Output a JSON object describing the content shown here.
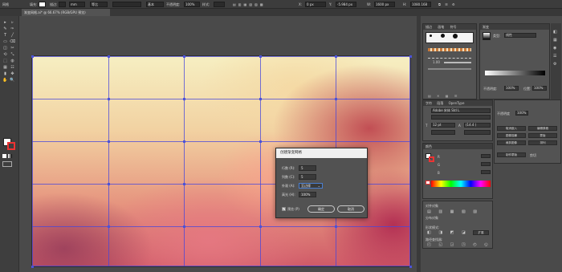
{
  "control_bar": {
    "object_type": "网格",
    "items": [
      {
        "name": "fill-label",
        "text": "填充:"
      },
      {
        "name": "stroke-label",
        "text": "描边:"
      },
      {
        "name": "stroke-weight",
        "text": "mm"
      },
      {
        "name": "brush-label",
        "text": "等比"
      },
      {
        "name": "style-label",
        "text": "基本"
      },
      {
        "name": "opacity-label",
        "text": "不透明度:"
      },
      {
        "name": "style2-label",
        "text": "样式:"
      }
    ],
    "basic_label": "基本",
    "opacity_value": "100%",
    "x_value": "0 px",
    "y_value": "-5.984 px",
    "w_value": "1600 px",
    "h_value": "1080.168"
  },
  "document_tab": {
    "title": "渐变网格.ai* @ 66.67% (RGB/GPU 预览)",
    "close": "×"
  },
  "toolbar": {
    "tools": [
      "▸",
      "▹",
      "✎",
      "✑",
      "T",
      "╱",
      "▭",
      "⌫",
      "◫",
      "✂",
      "⟲",
      "⤡",
      "⬚",
      "◍",
      "▦",
      "☷",
      "▮",
      "✥",
      "✋",
      "🔍"
    ]
  },
  "canvas": {
    "grid_rows": 5,
    "grid_cols": 5
  },
  "dialog": {
    "title": "创建渐变网格",
    "rows_label": "行数 (R):",
    "rows_value": "5",
    "cols_label": "列数 (C):",
    "cols_value": "5",
    "appearance_label": "外观 (A):",
    "appearance_value": "至边缘",
    "highlight_label": "高光 (H):",
    "highlight_value": "100%",
    "preview_label": "预览 (P)",
    "preview_checked": true,
    "ok_label": "确定",
    "cancel_label": "取消"
  },
  "panels": {
    "brushes": {
      "tabs": [
        "描边",
        "画笔",
        "符号"
      ],
      "stroke_weight_label": "1.00"
    },
    "gradient": {
      "tab": "渐变",
      "type_label": "类型:",
      "type_value": "线性",
      "opacity_label": "不透明度:",
      "opacity_value": "100%",
      "location_label": "位置:",
      "location_value": "100%"
    },
    "character": {
      "tabs": [
        "字符",
        "段落",
        "OpenType"
      ],
      "font": "Adobe 宋体 Std L",
      "size_value": "12 pt",
      "leading_value": "(14.4 )"
    },
    "color": {
      "tab": "颜色",
      "channels": [
        "R",
        "G",
        "B"
      ]
    },
    "transparency": {
      "opacity_label": "不透明度",
      "opacity_value": "100%",
      "mask_button": "制作蒙版",
      "clip_label": "剪切"
    },
    "align": {
      "label": "对齐对象",
      "dist_label": "分布对象"
    },
    "pathfinder": {
      "shape_label": "形状模式:",
      "path_label": "路径查找器:",
      "expand_button": "扩展"
    },
    "buttons": {
      "b1": "取消嵌入",
      "b2": "编辑原稿",
      "b3": "图像描摹",
      "b4": "蒙版",
      "b5": "裁剪图像",
      "b6": "排列"
    }
  }
}
